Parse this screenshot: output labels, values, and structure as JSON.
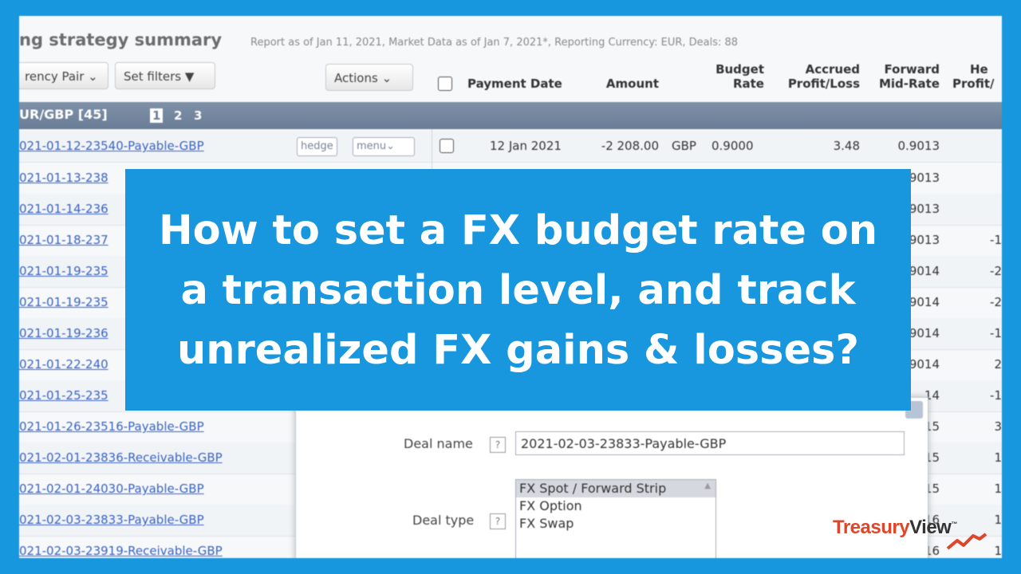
{
  "report": {
    "title": "ng strategy summary",
    "meta": "Report as of Jan 11, 2021, Market Data as of Jan 7, 2021*, Reporting Currency: EUR, Deals: 88"
  },
  "toolbar": {
    "currency_pair": "rency Pair",
    "set_filters": "Set filters",
    "actions": "Actions"
  },
  "columns": {
    "payment_date": "Payment Date",
    "amount": "Amount",
    "budget_rate_1": "Budget",
    "budget_rate_2": "Rate",
    "accrued_1": "Accrued",
    "accrued_2": "Profit/Loss",
    "forward_1": "Forward",
    "forward_2": "Mid-Rate",
    "hedge_1": "He",
    "hedge_2": "Profit/"
  },
  "group": {
    "label": "UR/GBP [45]",
    "pages": [
      "1",
      "2",
      "3"
    ]
  },
  "rows": [
    {
      "deal": "021-01-12-23540-Payable-GBP",
      "hedge": "hedge",
      "menu": "menu",
      "date": "12 Jan 2021",
      "amount": "-2 208.00",
      "ccy": "GBP",
      "budget": "0.9000",
      "accrued": "3.48",
      "fwd": "0.9013"
    },
    {
      "deal": "021-01-13-238",
      "fwd": "9013"
    },
    {
      "deal": "021-01-14-236",
      "fwd": "9013"
    },
    {
      "deal": "021-01-18-237",
      "fwd": "9013",
      "hedge_val": "-1"
    },
    {
      "deal": "021-01-19-235",
      "fwd": "9014",
      "hedge_val": "-2"
    },
    {
      "deal": "021-01-19-235",
      "fwd": "9014",
      "hedge_val": "-2"
    },
    {
      "deal": "021-01-19-236",
      "fwd": "9014",
      "hedge_val": "-1"
    },
    {
      "deal": "021-01-22-240",
      "fwd": "9014",
      "hedge_val": "2"
    },
    {
      "deal": "021-01-25-235",
      "fwd": "14",
      "hedge_val": "-1"
    },
    {
      "deal": "021-01-26-23516-Payable-GBP",
      "fwd": "15",
      "hedge_val": "3"
    },
    {
      "deal": "021-02-01-23836-Receivable-GBP",
      "fwd": "15",
      "hedge_val": "1"
    },
    {
      "deal": "021-02-01-24030-Payable-GBP",
      "fwd": "15",
      "hedge_val": "1"
    },
    {
      "deal": "021-02-03-23833-Payable-GBP",
      "fwd": "16",
      "hedge_val": "1"
    },
    {
      "deal": "021-02-03-23919-Receivable-GBP",
      "fwd": "16",
      "hedge_val": "1"
    }
  ],
  "dialog": {
    "deal_name_label": "Deal name",
    "deal_name_value": "2021-02-03-23833-Payable-GBP",
    "deal_type_label": "Deal type",
    "help": "?",
    "deal_types": [
      "FX Spot / Forward Strip",
      "FX Option",
      "FX Swap"
    ]
  },
  "banner": {
    "line1": "How to set a FX budget rate on",
    "line2": "a transaction level, and track",
    "line3": "unrealized FX gains & losses?"
  },
  "logo": {
    "part1": "Treasury",
    "part2": "View",
    "tm": "™"
  },
  "colors": {
    "frame_blue": "#1797de",
    "group_bar": "#6a7d96",
    "link": "#3a63c0",
    "logo_red": "#e0452a"
  }
}
